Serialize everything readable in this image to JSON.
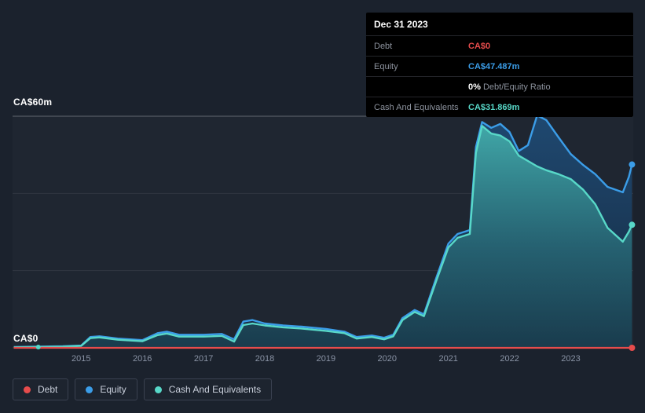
{
  "axis": {
    "y_top": "CA$60m",
    "y_bottom": "CA$0",
    "x_ticks": [
      "2015",
      "2016",
      "2017",
      "2018",
      "2019",
      "2020",
      "2021",
      "2022",
      "2023"
    ]
  },
  "tooltip": {
    "date": "Dec 31 2023",
    "debt_label": "Debt",
    "debt_value": "CA$0",
    "equity_label": "Equity",
    "equity_value": "CA$47.487m",
    "ratio_value": "0%",
    "ratio_label": "Debt/Equity Ratio",
    "cash_label": "Cash And Equivalents",
    "cash_value": "CA$31.869m"
  },
  "legend": {
    "debt": "Debt",
    "equity": "Equity",
    "cash": "Cash And Equivalents"
  },
  "colors": {
    "debt": "#e64c4c",
    "equity": "#3b9de8",
    "cash": "#58d8c8",
    "background": "#1b222d",
    "tooltip_background": "#000000"
  },
  "chart_data": {
    "type": "area",
    "unit": "CA$m",
    "ylim": [
      0,
      60
    ],
    "x_range": [
      2013.88,
      2024.02
    ],
    "y_gridlines": [
      0,
      20,
      40,
      60
    ],
    "x_ticks": [
      2015,
      2016,
      2017,
      2018,
      2019,
      2020,
      2021,
      2022,
      2023
    ],
    "y_axis_labels": {
      "top": "CA$60m",
      "bottom": "CA$0"
    },
    "legend_position": "bottom-left",
    "x": [
      2013.9,
      2014.3,
      2014.7,
      2015.0,
      2015.15,
      2015.3,
      2015.6,
      2016.0,
      2016.25,
      2016.4,
      2016.6,
      2017.0,
      2017.3,
      2017.5,
      2017.65,
      2017.8,
      2018.0,
      2018.3,
      2018.6,
      2019.0,
      2019.3,
      2019.5,
      2019.75,
      2019.95,
      2020.1,
      2020.25,
      2020.45,
      2020.6,
      2020.8,
      2021.0,
      2021.15,
      2021.35,
      2021.45,
      2021.55,
      2021.7,
      2021.85,
      2022.0,
      2022.15,
      2022.3,
      2022.45,
      2022.6,
      2022.8,
      2023.0,
      2023.2,
      2023.4,
      2023.6,
      2023.85,
      2023.95,
      2024.0
    ],
    "series": [
      {
        "name": "Debt",
        "color": "#e64c4c",
        "values": [
          0,
          0,
          0,
          0,
          0,
          0,
          0,
          0,
          0,
          0,
          0,
          0,
          0,
          0,
          0,
          0,
          0,
          0,
          0,
          0,
          0,
          0,
          0,
          0,
          0,
          0,
          0,
          0,
          0,
          0,
          0,
          0,
          0,
          0,
          0,
          0,
          0,
          0,
          0,
          0,
          0,
          0,
          0,
          0,
          0,
          0,
          0,
          0,
          0
        ]
      },
      {
        "name": "Equity",
        "color": "#3b9de8",
        "values": [
          0.2,
          0.3,
          0.4,
          0.6,
          2.8,
          3.0,
          2.4,
          2.0,
          3.8,
          4.2,
          3.4,
          3.4,
          3.6,
          2.2,
          6.8,
          7.2,
          6.3,
          5.8,
          5.5,
          4.9,
          4.2,
          2.8,
          3.2,
          2.6,
          3.4,
          7.7,
          9.8,
          8.7,
          18.0,
          27.0,
          29.5,
          30.5,
          52.0,
          58.5,
          57.0,
          58.0,
          55.9,
          51.0,
          52.5,
          60.2,
          59.0,
          54.5,
          50.2,
          47.4,
          45.0,
          41.7,
          40.3,
          44.3,
          47.487
        ]
      },
      {
        "name": "Cash And Equivalents",
        "color": "#58d8c8",
        "values": [
          0.15,
          0.2,
          0.3,
          0.5,
          2.5,
          2.7,
          2.1,
          1.7,
          3.3,
          3.7,
          2.9,
          2.9,
          3.1,
          1.6,
          5.9,
          6.3,
          5.8,
          5.3,
          5.0,
          4.4,
          3.8,
          2.4,
          2.8,
          2.2,
          3.0,
          7.2,
          9.3,
          8.2,
          17.2,
          26.0,
          28.5,
          29.5,
          50.5,
          57.5,
          55.5,
          55.0,
          53.5,
          49.8,
          48.4,
          47.0,
          46.0,
          45.0,
          43.7,
          41.0,
          37.2,
          31.1,
          27.5,
          30.1,
          31.869
        ]
      }
    ]
  }
}
